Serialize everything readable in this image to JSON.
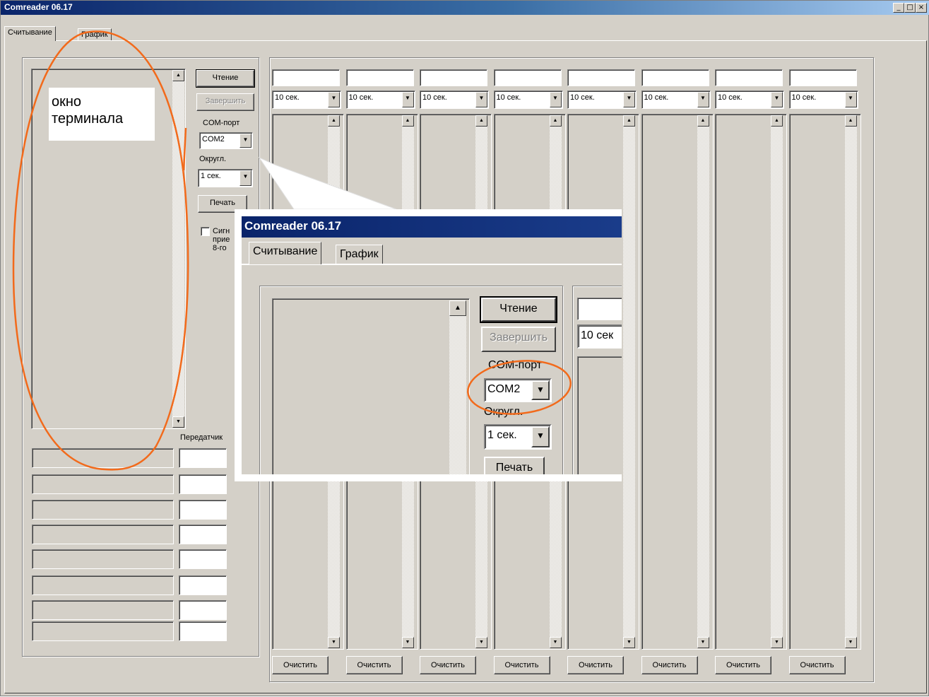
{
  "window": {
    "title": "Comreader 06.17"
  },
  "tabs": [
    "Считывание",
    "График"
  ],
  "controls": {
    "read_button": "Чтение",
    "finish_button": "Завершить",
    "com_label": "COM-порт",
    "com_value": "COM2",
    "round_label": "Округл.",
    "round_value": "1 сек.",
    "print_button": "Печать",
    "signal_checkbox_lines": [
      "Сигн",
      "прие",
      "8-го"
    ],
    "transmitters_label": "Передатчик"
  },
  "annotation": {
    "line1": "окно",
    "line2": "терминала"
  },
  "channels": [
    {
      "interval": "10 сек.",
      "clear": "Очистить"
    },
    {
      "interval": "10 сек.",
      "clear": "Очистить"
    },
    {
      "interval": "10 сек.",
      "clear": "Очистить"
    },
    {
      "interval": "10 сек.",
      "clear": "Очистить"
    },
    {
      "interval": "10 сек.",
      "clear": "Очистить"
    },
    {
      "interval": "10 сек.",
      "clear": "Очистить"
    },
    {
      "interval": "10 сек.",
      "clear": "Очистить"
    },
    {
      "interval": "10 сек.",
      "clear": "Очистить"
    }
  ],
  "zoom": {
    "title": "Comreader 06.17",
    "tabs": [
      "Считывание",
      "График"
    ],
    "read_button": "Чтение",
    "finish_button": "Завершить",
    "com_label": "COM-порт",
    "com_value": "COM2",
    "round_label": "Округл.",
    "round_value": "1 сек.",
    "print_button": "Печать",
    "interval_partial": "10 сек"
  },
  "colors": {
    "annotation": "#f26a1b",
    "titlebar_start": "#0a246a",
    "face": "#d4d0c8"
  }
}
